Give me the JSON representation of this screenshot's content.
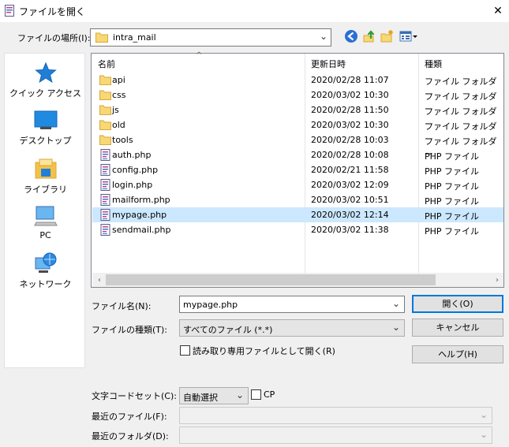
{
  "window": {
    "title": "ファイルを開く",
    "close_glyph": "✕"
  },
  "location": {
    "label": "ファイルの場所(I):",
    "value": "intra_mail",
    "toolbar_icons": [
      "back-icon",
      "up-folder-icon",
      "new-folder-icon",
      "view-menu-icon"
    ]
  },
  "places": [
    {
      "label": "クイック アクセス",
      "icon": "quick-access-star-icon"
    },
    {
      "label": "デスクトップ",
      "icon": "desktop-icon"
    },
    {
      "label": "ライブラリ",
      "icon": "library-icon"
    },
    {
      "label": "PC",
      "icon": "pc-icon"
    },
    {
      "label": "ネットワーク",
      "icon": "network-icon"
    }
  ],
  "filelist": {
    "sort_glyph": "^",
    "columns": {
      "name": "名前",
      "date": "更新日時",
      "type": "種類"
    },
    "rows": [
      {
        "name": "api",
        "date": "2020/02/28 11:07",
        "type": "ファイル フォルダー",
        "kind": "folder"
      },
      {
        "name": "css",
        "date": "2020/03/02 10:30",
        "type": "ファイル フォルダー",
        "kind": "folder"
      },
      {
        "name": "js",
        "date": "2020/02/28 11:50",
        "type": "ファイル フォルダー",
        "kind": "folder"
      },
      {
        "name": "old",
        "date": "2020/03/02 10:30",
        "type": "ファイル フォルダー",
        "kind": "folder"
      },
      {
        "name": "tools",
        "date": "2020/02/28 10:03",
        "type": "ファイル フォルダー",
        "kind": "folder"
      },
      {
        "name": "auth.php",
        "date": "2020/02/28 10:08",
        "type": "PHP ファイル",
        "kind": "php"
      },
      {
        "name": "config.php",
        "date": "2020/02/21 11:58",
        "type": "PHP ファイル",
        "kind": "php"
      },
      {
        "name": "login.php",
        "date": "2020/03/02 12:09",
        "type": "PHP ファイル",
        "kind": "php"
      },
      {
        "name": "mailform.php",
        "date": "2020/03/02 10:51",
        "type": "PHP ファイル",
        "kind": "php"
      },
      {
        "name": "mypage.php",
        "date": "2020/03/02 12:14",
        "type": "PHP ファイル",
        "kind": "php",
        "selected": true
      },
      {
        "name": "sendmail.php",
        "date": "2020/03/02 11:38",
        "type": "PHP ファイル",
        "kind": "php"
      }
    ],
    "scroll_left": "‹",
    "scroll_right": "›"
  },
  "filename": {
    "label": "ファイル名(N):",
    "value": "mypage.php"
  },
  "filetype": {
    "label": "ファイルの種類(T):",
    "value": "すべてのファイル (*.*)"
  },
  "readonly_checkbox": {
    "label": "読み取り専用ファイルとして開く(R)",
    "checked": false
  },
  "buttons": {
    "open": "開く(O)",
    "cancel": "キャンセル",
    "help": "ヘルプ(H)"
  },
  "encoding": {
    "label": "文字コードセット(C):",
    "value": "自動選択",
    "cp_label": "CP",
    "cp_checked": false
  },
  "recent_file": {
    "label": "最近のファイル(F):",
    "value": ""
  },
  "recent_folder": {
    "label": "最近のフォルダ(D):",
    "value": ""
  },
  "dropdown_glyph": "⌄",
  "colors": {
    "selection": "#cce8ff",
    "default_button_border": "#0078d7",
    "folder": "#f8d775"
  }
}
